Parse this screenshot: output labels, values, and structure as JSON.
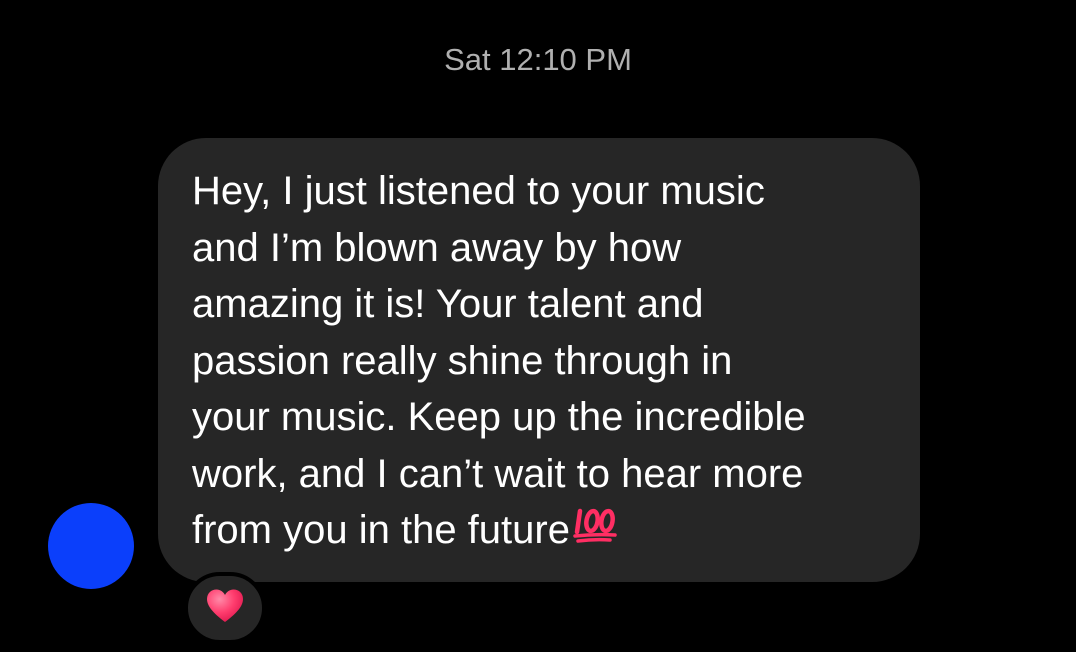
{
  "thread": {
    "timestamp": "Sat 12:10 PM"
  },
  "message": {
    "lines": [
      "Hey, I just listened to your music",
      "and I’m blown away by how",
      "amazing it is! Your talent and",
      "passion really shine through in",
      "your music. Keep up the incredible",
      "work, and I can’t wait to hear more",
      "from you in the future"
    ],
    "emoji": "hundred-points-icon"
  },
  "reaction": {
    "emoji": "heart-icon"
  },
  "colors": {
    "background": "#000000",
    "bubble": "#262626",
    "text": "#ffffff",
    "timestamp": "#b0b0b0",
    "avatar": "#0b3ffb",
    "heart": "#ff3d6e",
    "hundred": "#ff2e63"
  }
}
